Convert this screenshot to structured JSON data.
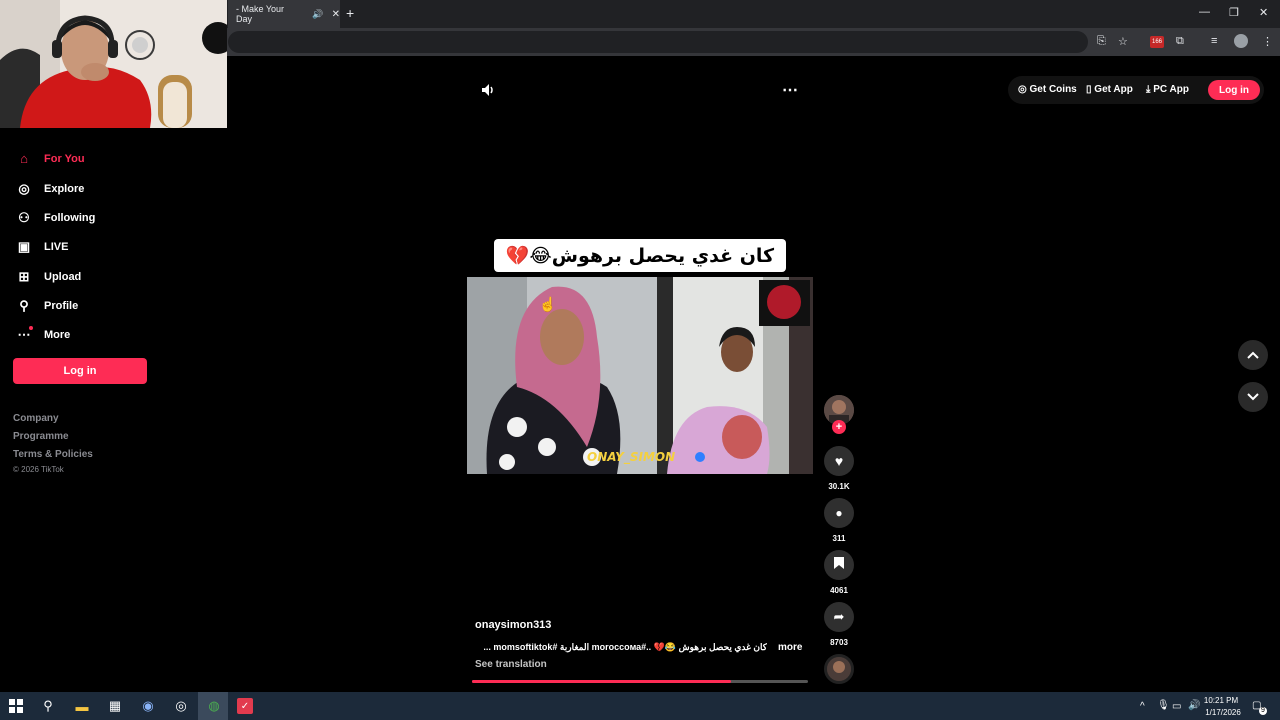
{
  "browser": {
    "tab_title": "- Make Your Day",
    "tab_audio_icon": "speaker-icon",
    "close_glyph": "✕",
    "new_tab_glyph": "+",
    "ext_badge": "166",
    "win_min": "—",
    "win_restore": "❐",
    "win_close": "✕"
  },
  "sidebar": {
    "items": [
      {
        "label": "For You",
        "icon": "home-icon",
        "active": true
      },
      {
        "label": "Explore",
        "icon": "compass-icon"
      },
      {
        "label": "Following",
        "icon": "following-icon"
      },
      {
        "label": "LIVE",
        "icon": "live-icon"
      },
      {
        "label": "Upload",
        "icon": "upload-icon"
      },
      {
        "label": "Profile",
        "icon": "profile-icon"
      },
      {
        "label": "More",
        "icon": "more-dots-icon"
      }
    ],
    "login_label": "Log in",
    "footer_links": [
      "Company",
      "Programme",
      "Terms & Policies"
    ],
    "copyright": "© 2026 TikTok"
  },
  "top_actions": {
    "get_coins": "Get Coins",
    "get_app": "Get App",
    "pc_app": "PC App",
    "login": "Log in"
  },
  "video": {
    "caption_overlay": "كان غدي يحصل برهوش😂💔",
    "watermark": "ONAY_SIMON",
    "author": "onaysimon313",
    "description": "كان غدي يحصل برهوش 😂💔 ..#moroccoма المغاربة #momsoftiktok ...",
    "more_label": "more",
    "see_translation": "See translation",
    "progress_fraction": 0.77
  },
  "actions": {
    "likes": "30.1K",
    "comments": "311",
    "saves": "4061",
    "shares": "8703"
  },
  "taskbar": {
    "time": "10:21 PM",
    "date": "1/17/2026",
    "notif_count": "9"
  },
  "colors": {
    "accent": "#fe2c55",
    "taskbar": "#1c2a3a"
  }
}
